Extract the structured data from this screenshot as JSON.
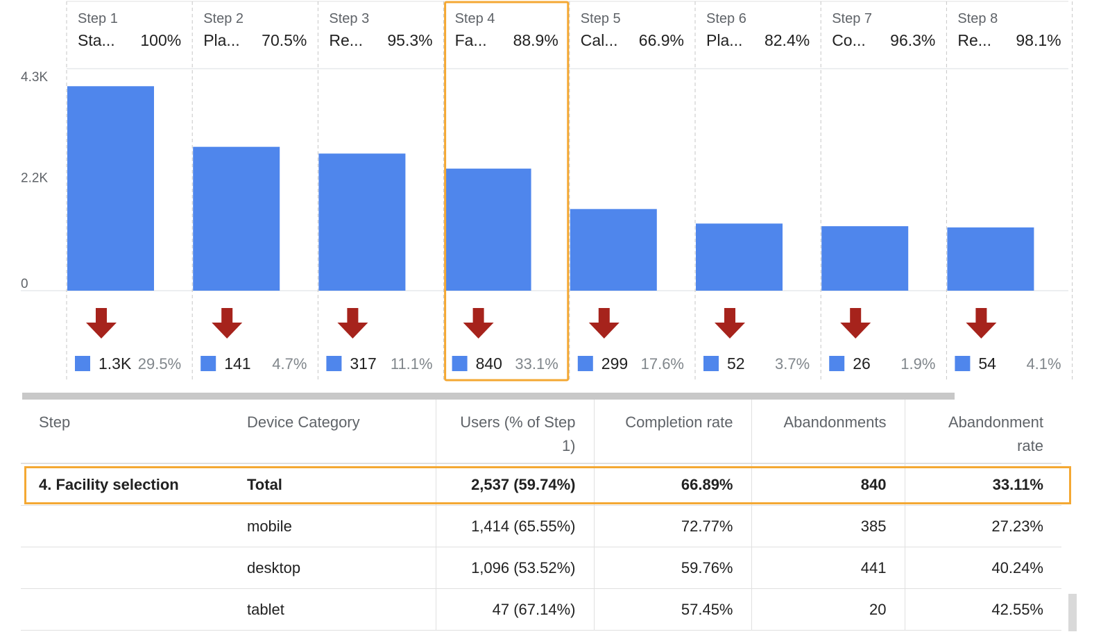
{
  "chart_data": {
    "type": "bar",
    "categories": [
      "Step 1",
      "Step 2",
      "Step 3",
      "Step 4",
      "Step 5",
      "Step 6",
      "Step 7",
      "Step 8"
    ],
    "step_names": [
      "Sta...",
      "Pla...",
      "Re...",
      "Fa...",
      "Cal...",
      "Pla...",
      "Co...",
      "Re..."
    ],
    "rates": [
      "100%",
      "70.5%",
      "95.3%",
      "88.9%",
      "66.9%",
      "82.4%",
      "96.3%",
      "98.1%"
    ],
    "values": [
      4250,
      2990,
      2850,
      2537,
      1697,
      1395,
      1340,
      1315
    ],
    "ylim": [
      0,
      4600
    ],
    "yticks": [
      {
        "value": 0,
        "label": "0"
      },
      {
        "value": 2200,
        "label": "2.2K"
      },
      {
        "value": 4300,
        "label": "4.3K"
      }
    ],
    "drop_values": [
      "1.3K",
      "141",
      "317",
      "840",
      "299",
      "52",
      "26",
      "54"
    ],
    "drop_percents": [
      "29.5%",
      "4.7%",
      "11.1%",
      "33.1%",
      "17.6%",
      "3.7%",
      "1.9%",
      "4.1%"
    ],
    "highlighted_step": 4,
    "grid": true,
    "colors": {
      "bar": "#4f86ec",
      "drop_arrow": "#a6231c",
      "drop_marker": "#4f86ec",
      "highlight": "#f4a833"
    }
  },
  "table": {
    "headers": [
      "Step",
      "Device Category",
      "Users (% of Step 1)",
      "Completion rate",
      "Abandonments",
      "Abandonment rate"
    ],
    "rows": [
      [
        "4. Facility selection",
        "Total",
        "2,537 (59.74%)",
        "66.89%",
        "840",
        "33.11%"
      ],
      [
        "",
        "mobile",
        "1,414 (65.55%)",
        "72.77%",
        "385",
        "27.23%"
      ],
      [
        "",
        "desktop",
        "1,096 (53.52%)",
        "59.76%",
        "441",
        "40.24%"
      ],
      [
        "",
        "tablet",
        "47 (67.14%)",
        "57.45%",
        "20",
        "42.55%"
      ]
    ]
  }
}
